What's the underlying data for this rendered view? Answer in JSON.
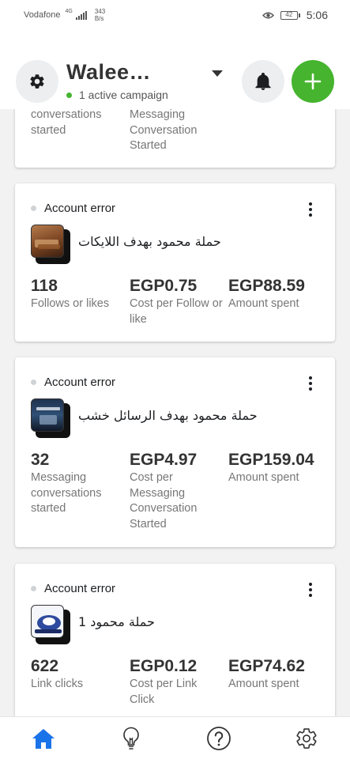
{
  "status_bar": {
    "carrier": "Vodafone",
    "network": "4G",
    "speed_value": "343",
    "speed_unit": "B/s",
    "battery": "42",
    "time": "5:06"
  },
  "header": {
    "account_name": "Walee…",
    "active_campaigns": "1 active campaign",
    "accent_color": "#46b42e"
  },
  "cards": [
    {
      "metrics": [
        {
          "value": "",
          "label": "conversations started"
        },
        {
          "value": "",
          "label": "Messaging Conversation Started"
        }
      ]
    },
    {
      "status": "Account error",
      "name": "حملة محمود بهدف اللايكات",
      "metrics": [
        {
          "value": "118",
          "label": "Follows or likes"
        },
        {
          "value": "EGP0.75",
          "label": "Cost per Follow or like"
        },
        {
          "value": "EGP88.59",
          "label": "Amount spent"
        }
      ]
    },
    {
      "status": "Account error",
      "name": "حملة محمود بهدف الرسائل خشب",
      "metrics": [
        {
          "value": "32",
          "label": "Messaging conversations started"
        },
        {
          "value": "EGP4.97",
          "label": "Cost per Messaging Conversation Started"
        },
        {
          "value": "EGP159.04",
          "label": "Amount spent"
        }
      ]
    },
    {
      "status": "Account error",
      "name": "حملة محمود 1",
      "metrics": [
        {
          "value": "622",
          "label": "Link clicks"
        },
        {
          "value": "EGP0.12",
          "label": "Cost per Link Click"
        },
        {
          "value": "EGP74.62",
          "label": "Amount spent"
        }
      ]
    }
  ],
  "icons": {
    "header": [
      "gear-icon",
      "bell-icon",
      "plus-icon"
    ],
    "card": [
      "more-vertical-icon"
    ],
    "bottom_nav": [
      "home-icon",
      "lightbulb-icon",
      "help-icon",
      "settings-icon"
    ]
  }
}
